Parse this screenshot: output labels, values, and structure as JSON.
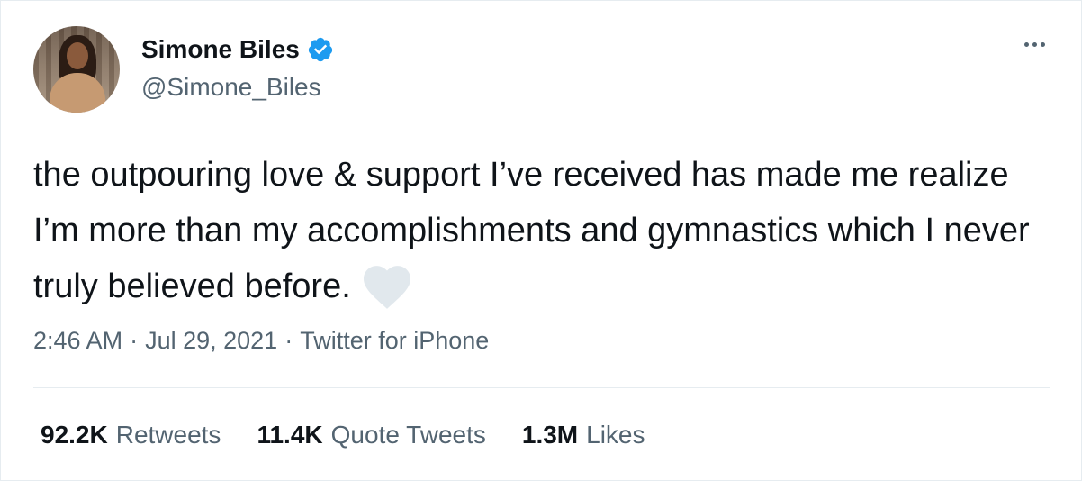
{
  "author": {
    "name": "Simone Biles",
    "handle": "@Simone_Biles",
    "verified": true
  },
  "tweet": {
    "text": "the outpouring love & support I’ve received has made me realize I’m more than my accomplishments and gymnastics which I never truly believed before.",
    "emoji": "white-heart-icon"
  },
  "meta": {
    "time": "2:46 AM",
    "separator1": "·",
    "date": "Jul 29, 2021",
    "separator2": "·",
    "source": "Twitter for iPhone"
  },
  "stats": {
    "retweets_count": "92.2K",
    "retweets_label": "Retweets",
    "quotes_count": "11.4K",
    "quotes_label": "Quote Tweets",
    "likes_count": "1.3M",
    "likes_label": "Likes"
  },
  "colors": {
    "text_primary": "#0f1419",
    "text_secondary": "#536471",
    "verified_blue": "#1d9bf0",
    "heart_grey": "#e1e8ed",
    "divider": "#e6ecf0"
  }
}
